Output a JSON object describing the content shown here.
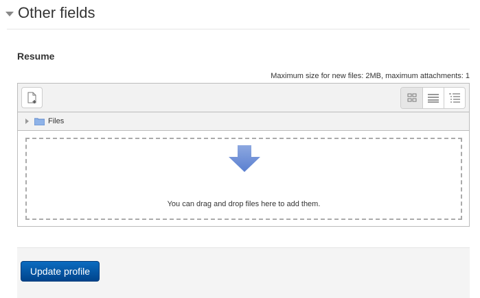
{
  "section": {
    "title": "Other fields"
  },
  "field": {
    "label": "Resume",
    "max_size": "Maximum size for new files: 2MB, maximum attachments: 1"
  },
  "filemanager": {
    "path_label": "Files",
    "drop_message": "You can drag and drop files here to add them."
  },
  "footer": {
    "submit_label": "Update profile"
  },
  "colors": {
    "button": "#0b5fad",
    "arrow": "#6f8fd6"
  }
}
